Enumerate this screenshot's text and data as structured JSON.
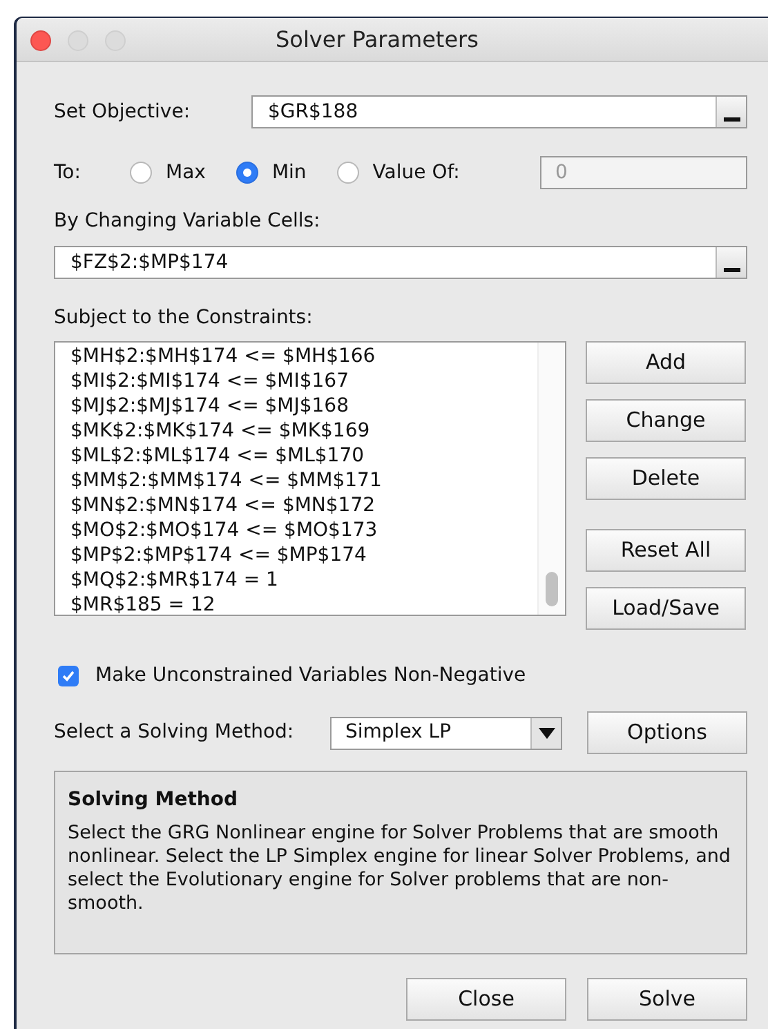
{
  "window": {
    "title": "Solver Parameters"
  },
  "objective": {
    "label": "Set Objective:",
    "value": "$GR$188"
  },
  "to": {
    "label": "To:",
    "options": [
      {
        "label": "Max",
        "selected": false
      },
      {
        "label": "Min",
        "selected": true
      },
      {
        "label": "Value Of:",
        "selected": false
      }
    ],
    "value_field": {
      "value": "0",
      "disabled": true
    }
  },
  "changing": {
    "label": "By Changing Variable Cells:",
    "value": "$FZ$2:$MP$174"
  },
  "constraints": {
    "label": "Subject to the Constraints:",
    "items": [
      "$MH$2:$MH$174 <= $MH$166",
      "$MI$2:$MI$174 <= $MI$167",
      "$MJ$2:$MJ$174 <= $MJ$168",
      "$MK$2:$MK$174 <= $MK$169",
      "$ML$2:$ML$174 <= $ML$170",
      "$MM$2:$MM$174 <= $MM$171",
      "$MN$2:$MN$174 <= $MN$172",
      "$MO$2:$MO$174 <= $MO$173",
      "$MP$2:$MP$174 <= $MP$174",
      "$MQ$2:$MR$174 = 1",
      "$MR$185 = 12"
    ],
    "buttons": [
      "Add",
      "Change",
      "Delete"
    ],
    "file_buttons": [
      "Reset All",
      "Load/Save"
    ]
  },
  "non_negative": {
    "label": "Make Unconstrained Variables Non-Negative",
    "checked": true
  },
  "method": {
    "label": "Select a Solving Method:",
    "value": "Simplex LP",
    "options_button": "Options"
  },
  "description": {
    "title": "Solving Method",
    "text": "Select the GRG Nonlinear engine for Solver Problems that are smooth nonlinear. Select the LP Simplex engine for linear Solver Problems, and select the Evolutionary engine for Solver problems that are non-smooth."
  },
  "footer_buttons": [
    "Close",
    "Solve"
  ]
}
